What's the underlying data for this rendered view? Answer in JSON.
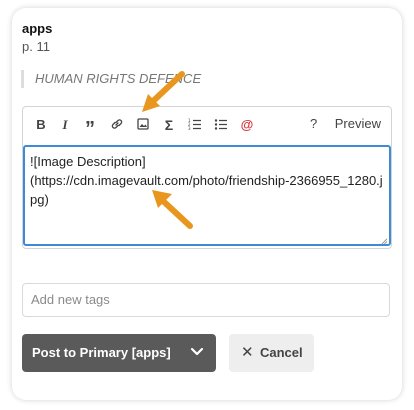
{
  "header": {
    "title": "apps",
    "page": "p. 11"
  },
  "quote": "HUMAN RIGHTS DEFENCE",
  "toolbar": {
    "bold": "B",
    "italic": "I",
    "quote": "”",
    "link_icon": "link-icon",
    "image_icon": "image-icon",
    "sum": "Σ",
    "ordered_list_icon": "ordered-list-icon",
    "bullet_list_icon": "bullet-list-icon",
    "mention": "@",
    "help": "?",
    "preview": "Preview"
  },
  "editor": {
    "value": "![Image Description]\n(https://cdn.imagevault.com/photo/friendship-2366955_1280.jpg)"
  },
  "tags": {
    "placeholder": "Add new tags"
  },
  "actions": {
    "post_label": "Post to Primary [apps]",
    "cancel_label": "Cancel",
    "cancel_icon": "✕"
  },
  "colors": {
    "accent": "#3f8ad6",
    "annotation_arrow": "#e8961e",
    "mention": "#d9363e",
    "post_button": "#5a5a5a"
  }
}
